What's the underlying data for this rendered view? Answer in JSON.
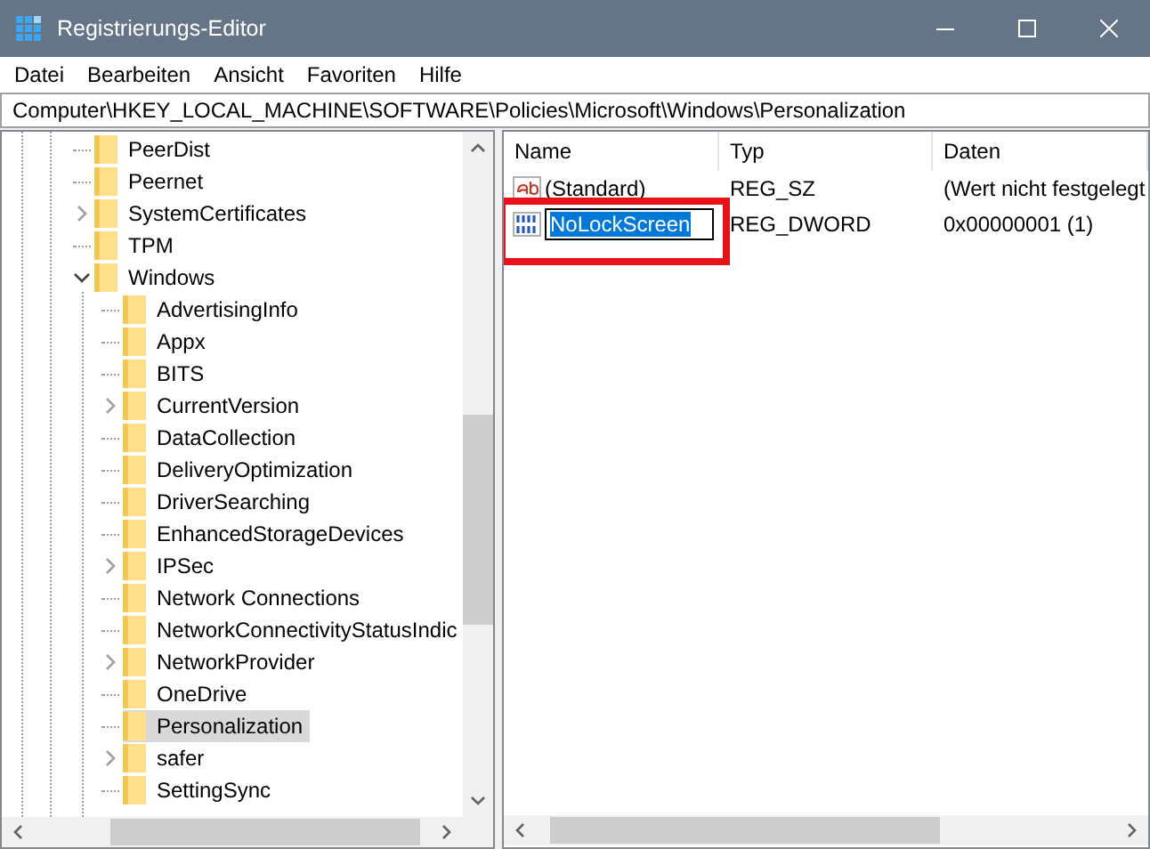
{
  "window": {
    "title": "Registrierungs-Editor"
  },
  "menu": [
    "Datei",
    "Bearbeiten",
    "Ansicht",
    "Favoriten",
    "Hilfe"
  ],
  "address": "Computer\\HKEY_LOCAL_MACHINE\\SOFTWARE\\Policies\\Microsoft\\Windows\\Personalization",
  "tree": [
    {
      "label": "PeerDist",
      "kind": "leaf",
      "selected": false
    },
    {
      "label": "Peernet",
      "kind": "leaf",
      "selected": false
    },
    {
      "label": "SystemCertificates",
      "kind": "collapsed",
      "selected": false
    },
    {
      "label": "TPM",
      "kind": "leaf",
      "selected": false
    },
    {
      "label": "Windows",
      "kind": "expanded",
      "selected": false,
      "children": [
        {
          "label": "AdvertisingInfo",
          "kind": "leaf",
          "selected": false
        },
        {
          "label": "Appx",
          "kind": "leaf",
          "selected": false
        },
        {
          "label": "BITS",
          "kind": "leaf",
          "selected": false
        },
        {
          "label": "CurrentVersion",
          "kind": "collapsed",
          "selected": false
        },
        {
          "label": "DataCollection",
          "kind": "leaf",
          "selected": false
        },
        {
          "label": "DeliveryOptimization",
          "kind": "leaf",
          "selected": false
        },
        {
          "label": "DriverSearching",
          "kind": "leaf",
          "selected": false
        },
        {
          "label": "EnhancedStorageDevices",
          "kind": "leaf",
          "selected": false
        },
        {
          "label": "IPSec",
          "kind": "collapsed",
          "selected": false
        },
        {
          "label": "Network Connections",
          "kind": "leaf",
          "selected": false
        },
        {
          "label": "NetworkConnectivityStatusIndic",
          "kind": "leaf",
          "selected": false
        },
        {
          "label": "NetworkProvider",
          "kind": "collapsed",
          "selected": false
        },
        {
          "label": "OneDrive",
          "kind": "leaf",
          "selected": false
        },
        {
          "label": "Personalization",
          "kind": "leaf",
          "selected": true
        },
        {
          "label": "safer",
          "kind": "collapsed",
          "selected": false
        },
        {
          "label": "SettingSync",
          "kind": "leaf",
          "selected": false
        }
      ]
    }
  ],
  "columns": [
    "Name",
    "Typ",
    "Daten"
  ],
  "values": [
    {
      "kind": "string",
      "name": "(Standard)",
      "type": "REG_SZ",
      "data": "(Wert nicht festgelegt",
      "editing": false,
      "highlighted": false
    },
    {
      "kind": "binary",
      "name": "NoLockScreen",
      "type": "REG_DWORD",
      "data": "0x00000001 (1)",
      "editing": true,
      "highlighted": true
    }
  ]
}
